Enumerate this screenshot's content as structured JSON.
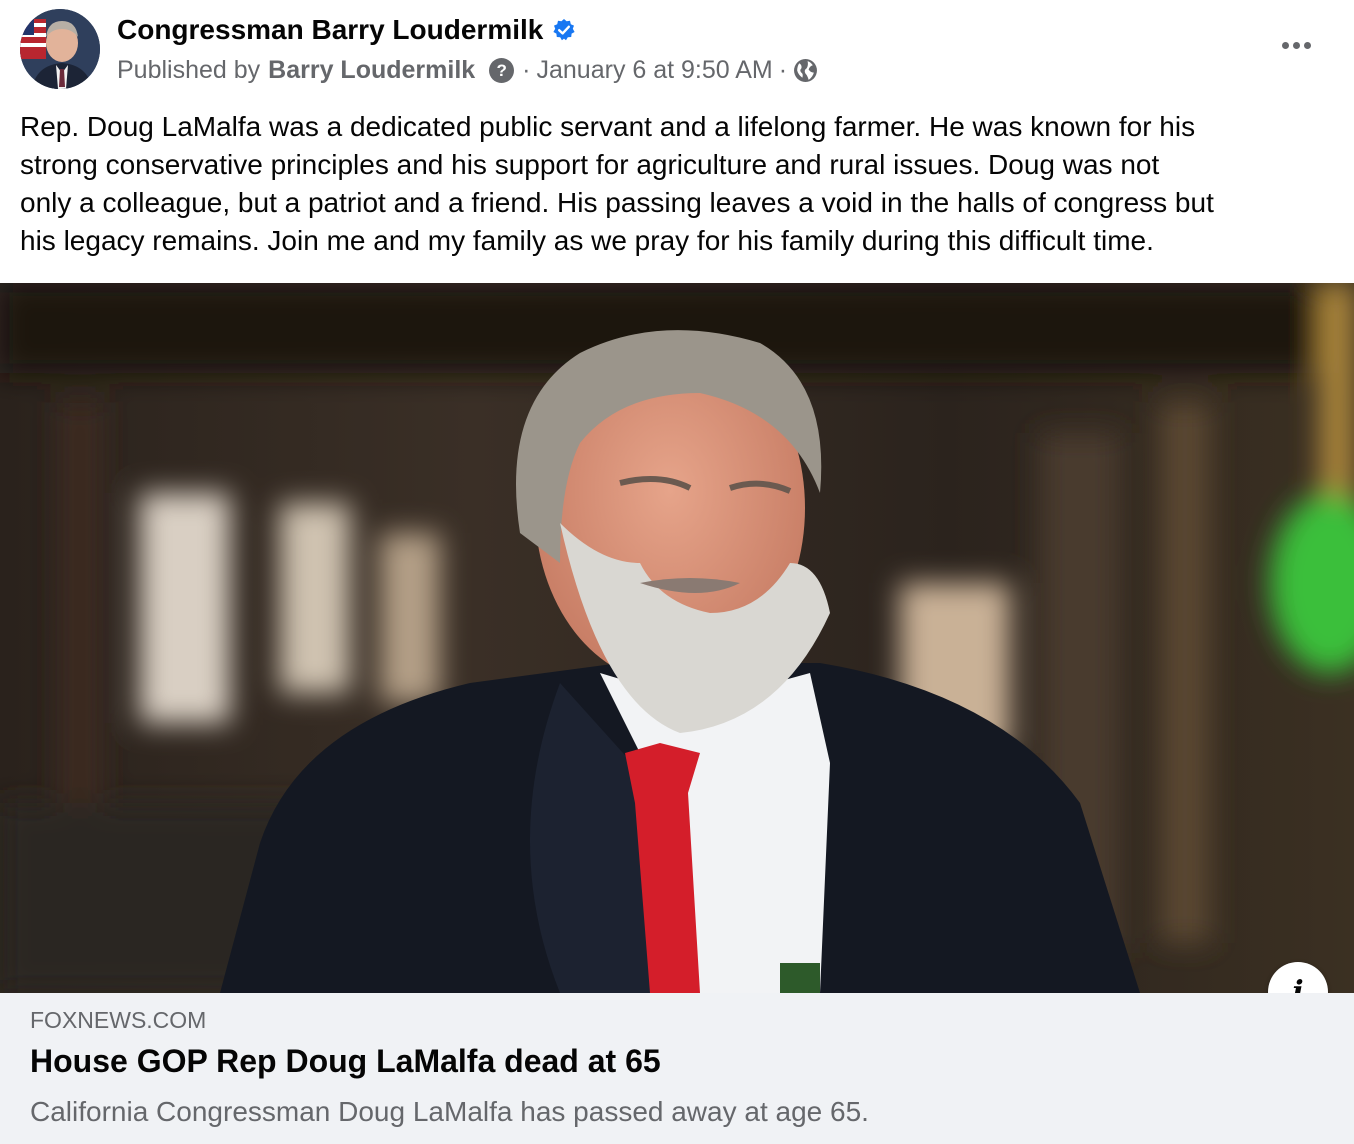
{
  "post": {
    "page_name": "Congressman Barry Loudermilk",
    "published_by_prefix": "Published by",
    "published_by_name": "Barry Loudermilk",
    "separator": "·",
    "timestamp": "January 6 at 9:50 AM",
    "audience_icon": "globe-icon",
    "verified_icon": "verified-badge-icon",
    "more_icon": "ellipsis-icon",
    "text_lines": [
      "Rep. Doug LaMalfa was a dedicated public servant and a lifelong farmer.  He was known for his",
      "strong conservative principles and his support for agriculture and rural issues. Doug was not",
      "only a colleague, but a patriot and a friend. His passing leaves a void in the halls of congress but",
      "his legacy remains. Join me and my family as we pray for his family during this difficult time."
    ]
  },
  "link_preview": {
    "domain": "FOXNEWS.COM",
    "headline": "House GOP Rep Doug LaMalfa dead at 65",
    "description": "California Congressman Doug LaMalfa has passed away at age 65.",
    "info_label": "i"
  },
  "colors": {
    "text_primary": "#050505",
    "text_secondary": "#65676b",
    "verified_blue": "#1877f2",
    "card_background": "#f0f2f5",
    "tie_red": "#d41e2a"
  }
}
